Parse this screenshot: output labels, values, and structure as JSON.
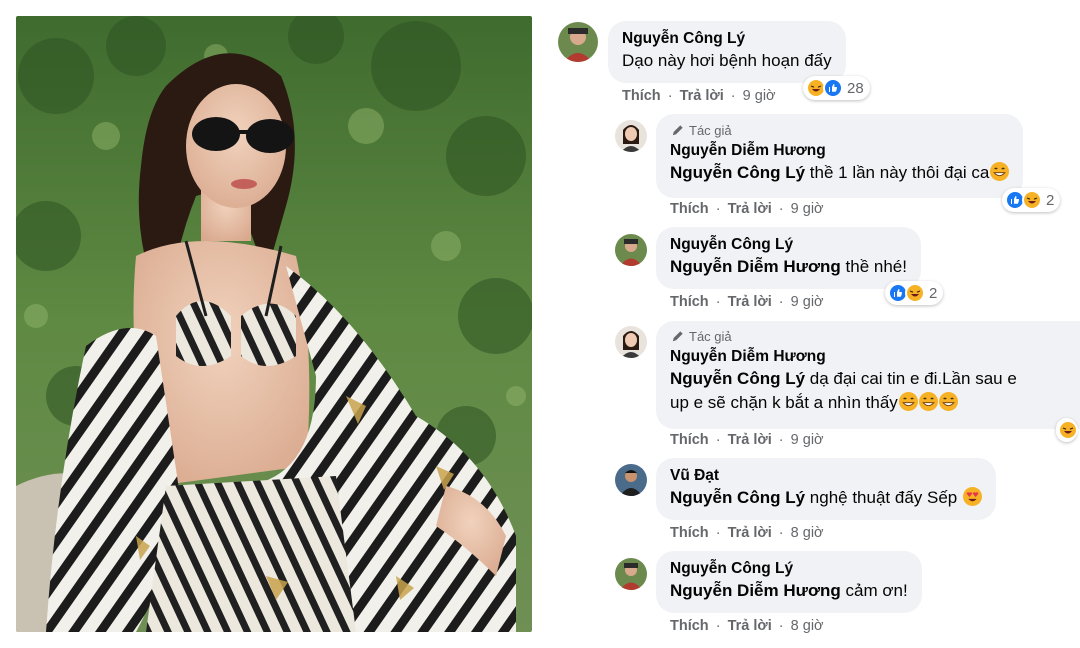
{
  "post": {
    "photo_alt": "",
    "photo_icon": "photo-image"
  },
  "labels": {
    "like": "Thích",
    "reply": "Trả lời",
    "author_badge": "Tác giả",
    "separator": "·"
  },
  "comments": [
    {
      "author": "Nguyễn Công Lý",
      "is_author": false,
      "mention": "",
      "text": "Dạo này hơi bệnh hoạn đấy",
      "time": "9 giờ",
      "reactions": [
        "haha",
        "like"
      ],
      "reaction_count": "28"
    },
    {
      "author": "Nguyễn Diễm Hương",
      "is_author": true,
      "mention": "Nguyễn Công Lý",
      "text": "thề 1 lần này thôi đại ca",
      "text_emoji": "grin",
      "time": "9 giờ",
      "reactions": [
        "like",
        "haha"
      ],
      "reaction_count": "2"
    },
    {
      "author": "Nguyễn Công Lý",
      "is_author": false,
      "mention": "Nguyễn Diễm Hương",
      "text": "thề nhé!",
      "time": "9 giờ",
      "reactions": [
        "like",
        "haha"
      ],
      "reaction_count": "2"
    },
    {
      "author": "Nguyễn Diễm Hương",
      "is_author": true,
      "mention": "Nguyễn Công Lý",
      "text": "dạ đại cai tin e đi.Lần sau e",
      "text_line2": "up e sẽ chặn k bắt a nhìn thấy",
      "text_emoji": "grin",
      "time": "9 giờ",
      "reactions": [
        "haha"
      ],
      "reaction_count": ""
    },
    {
      "author": "Vũ Đạt",
      "is_author": false,
      "mention": "Nguyễn Công Lý",
      "text": "nghệ thuật đấy Sếp",
      "text_emoji": "heart-eyes",
      "time": "8 giờ",
      "reactions": [],
      "reaction_count": ""
    },
    {
      "author": "Nguyễn Công Lý",
      "is_author": false,
      "mention": "Nguyễn Diễm Hương",
      "text": "cảm ơn!",
      "time": "8 giờ",
      "reactions": [],
      "reaction_count": ""
    }
  ],
  "colors": {
    "bubble": "#f0f2f5",
    "meta_text": "#65676b",
    "like_blue": "#1877f2",
    "haha_yellow": "#f7b125"
  }
}
